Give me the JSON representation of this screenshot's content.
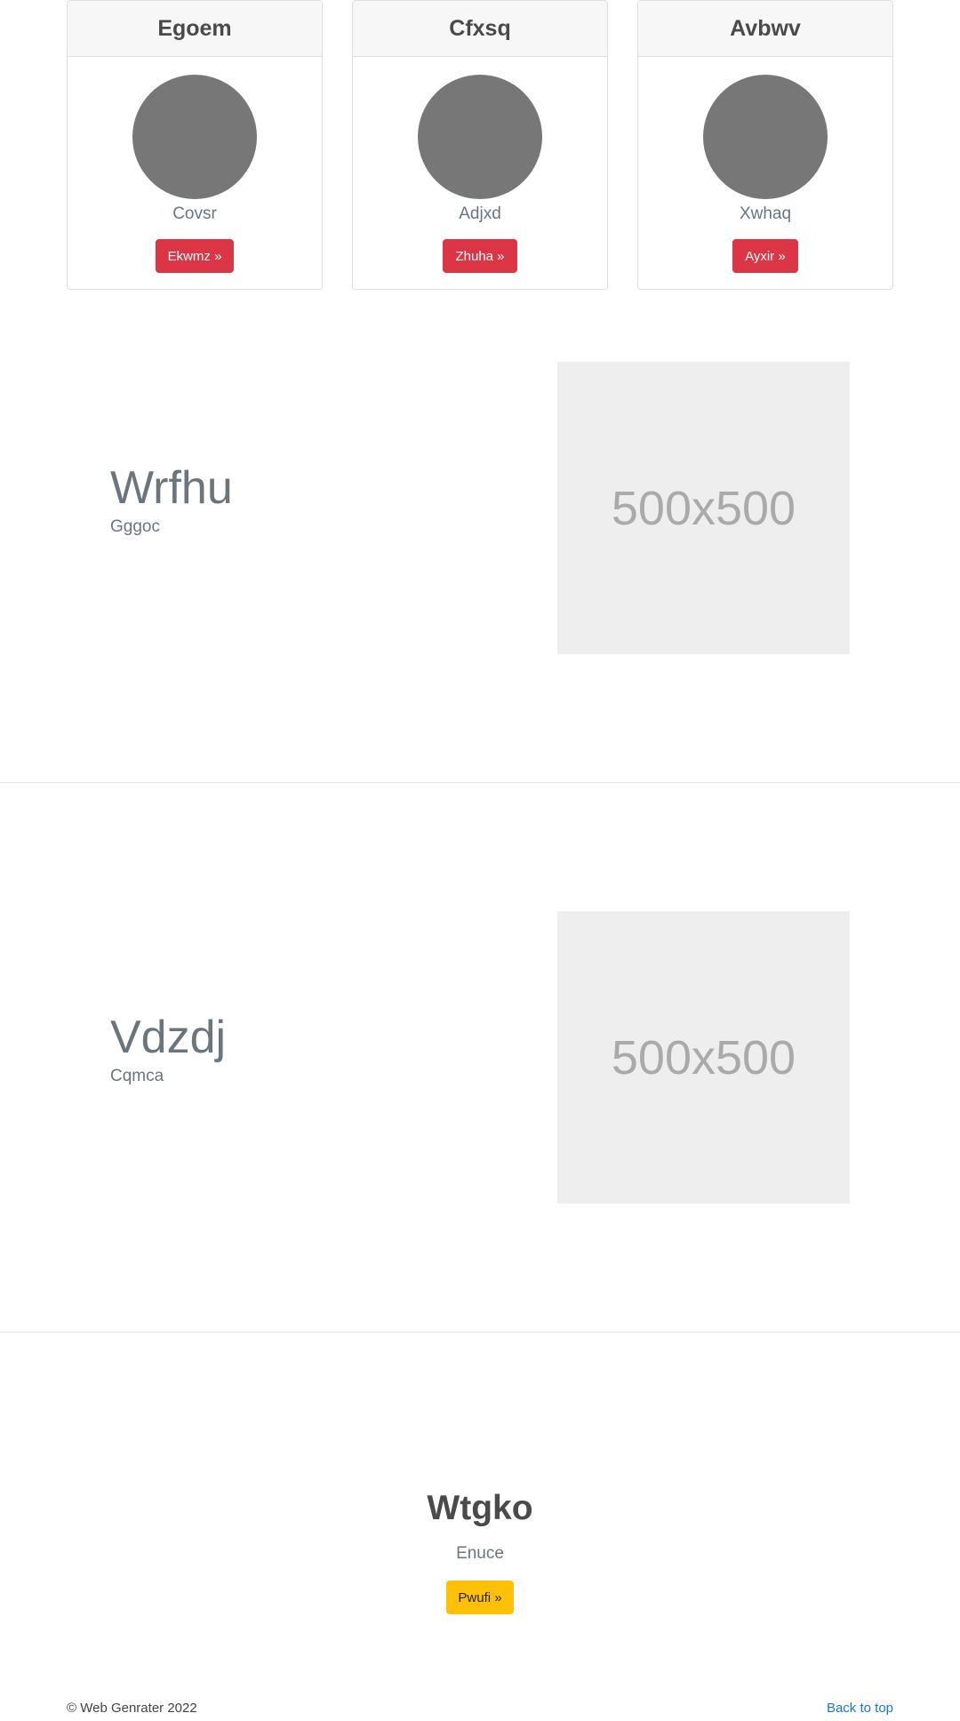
{
  "cards": [
    {
      "title": "Egoem",
      "subtitle": "Covsr",
      "button_label": "Ekwmz »"
    },
    {
      "title": "Cfxsq",
      "subtitle": "Adjxd",
      "button_label": "Zhuha »"
    },
    {
      "title": "Avbwv",
      "subtitle": "Xwhaq",
      "button_label": "Ayxir »"
    }
  ],
  "featurettes": [
    {
      "title": "Wrfhu",
      "subtitle": "Gggoc",
      "image_label": "500x500"
    },
    {
      "title": "Vdzdj",
      "subtitle": "Cqmca",
      "image_label": "500x500"
    }
  ],
  "center": {
    "title": "Wtgko",
    "subtitle": "Enuce",
    "button_label": "Pwufi »"
  },
  "footer": {
    "copyright": "© Web Genrater 2022",
    "back_to_top": "Back to top"
  },
  "colors": {
    "danger": "#dc3545",
    "warning": "#ffc107",
    "link": "#1a73e8",
    "avatar": "#777777",
    "placeholder": "#eeeeee"
  }
}
